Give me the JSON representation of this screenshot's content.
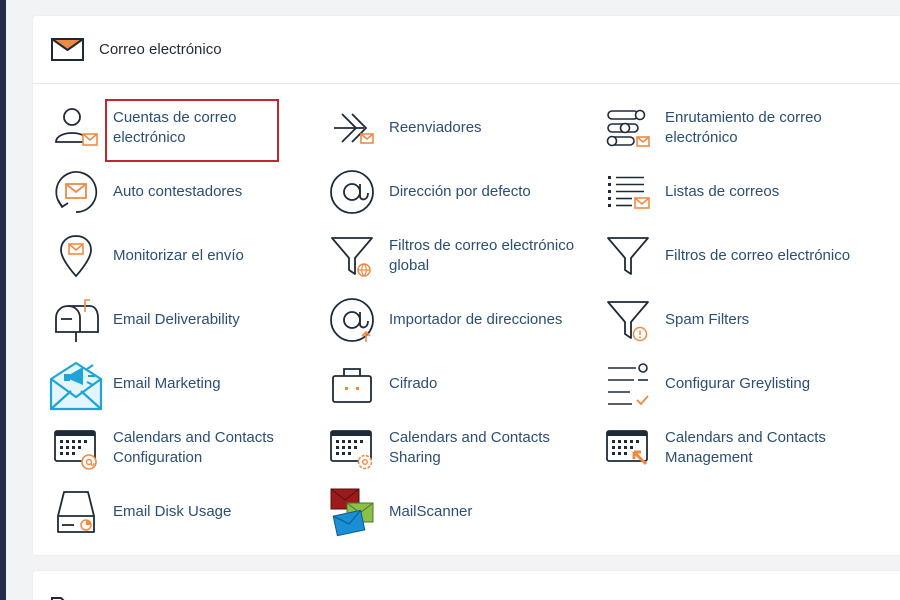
{
  "section": {
    "title": "Correo electrónico",
    "icon": "envelope-icon"
  },
  "items": [
    {
      "label": "Cuentas de correo electrónico",
      "icon": "email-accounts-icon",
      "selected": true
    },
    {
      "label": "Reenviadores",
      "icon": "forwarders-icon"
    },
    {
      "label": "Enrutamiento de correo electrónico",
      "icon": "email-routing-icon"
    },
    {
      "label": "Auto contestadores",
      "icon": "autoresponders-icon"
    },
    {
      "label": "Dirección por defecto",
      "icon": "default-address-icon"
    },
    {
      "label": "Listas de correos",
      "icon": "mailing-lists-icon"
    },
    {
      "label": "Monitorizar el envío",
      "icon": "track-delivery-icon"
    },
    {
      "label": "Filtros de correo electrónico global",
      "icon": "global-filter-icon"
    },
    {
      "label": "Filtros de correo electrónico",
      "icon": "email-filter-icon"
    },
    {
      "label": "Email Deliverability",
      "icon": "mailbox-icon"
    },
    {
      "label": "Importador de direcciones",
      "icon": "address-importer-icon"
    },
    {
      "label": "Spam Filters",
      "icon": "spam-filter-icon"
    },
    {
      "label": "Email Marketing",
      "icon": "email-marketing-icon"
    },
    {
      "label": "Cifrado",
      "icon": "encryption-icon"
    },
    {
      "label": "Configurar Greylisting",
      "icon": "greylisting-icon"
    },
    {
      "label": "Calendars and Contacts Configuration",
      "icon": "calendar-config-icon"
    },
    {
      "label": "Calendars and Contacts Sharing",
      "icon": "calendar-sharing-icon"
    },
    {
      "label": "Calendars and Contacts Management",
      "icon": "calendar-management-icon"
    },
    {
      "label": "Email Disk Usage",
      "icon": "disk-usage-icon"
    },
    {
      "label": "MailScanner",
      "icon": "mailscanner-icon"
    }
  ],
  "colors": {
    "accent": "#f08a43",
    "link": "#2b4f73",
    "selection": "#c0262d",
    "sidebar": "#262a4d"
  }
}
